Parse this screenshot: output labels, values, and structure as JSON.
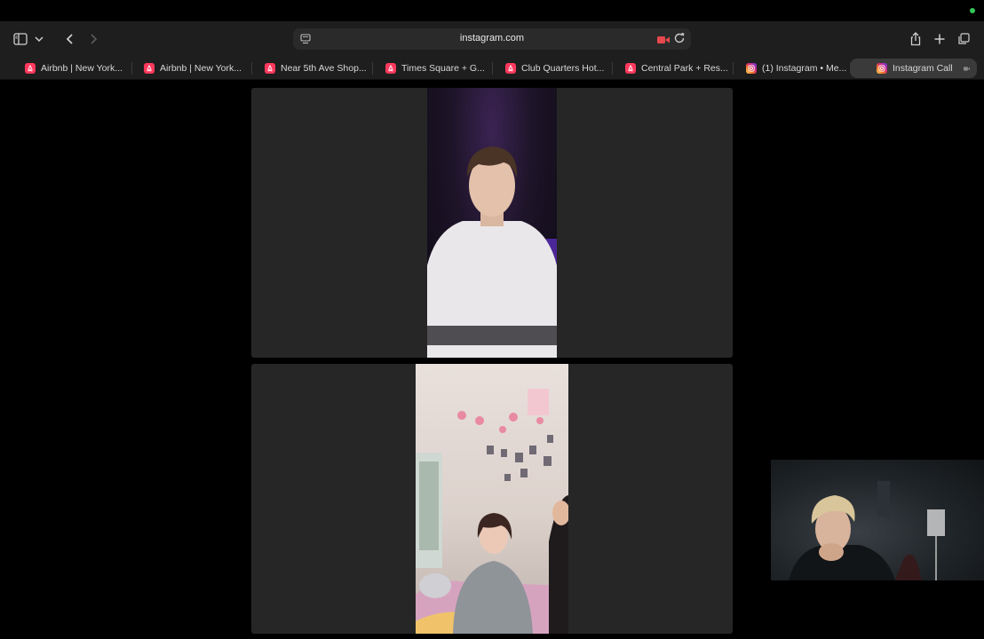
{
  "browser": {
    "address": "instagram.com"
  },
  "tabs": [
    {
      "label": "Airbnb | New York...",
      "favicon": "airbnb-icon"
    },
    {
      "label": "Airbnb | New York...",
      "favicon": "airbnb-icon"
    },
    {
      "label": "Near 5th Ave Shop...",
      "favicon": "airbnb-icon"
    },
    {
      "label": "Times Square + G...",
      "favicon": "airbnb-icon"
    },
    {
      "label": "Club Quarters Hot...",
      "favicon": "airbnb-icon"
    },
    {
      "label": "Central Park + Res...",
      "favicon": "airbnb-icon"
    },
    {
      "label": "(1) Instagram • Me...",
      "favicon": "instagram-icon"
    },
    {
      "label": "Instagram Call",
      "favicon": "instagram-icon",
      "active": true
    }
  ],
  "colors": {
    "airbnb": "#ff385c",
    "recording": "#e5484d",
    "status": "#34c759"
  }
}
